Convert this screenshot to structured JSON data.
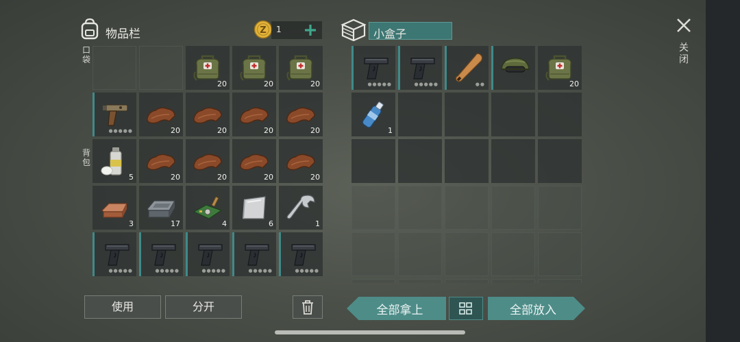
{
  "inventory": {
    "title": "物品栏",
    "coin_count": "1"
  },
  "container": {
    "title": "小盒子"
  },
  "side_labels": {
    "pocket": "口袋",
    "backpack": "背包"
  },
  "close_label": "关闭",
  "buttons": {
    "use": "使用",
    "split": "分开",
    "take_all": "全部拿上",
    "put_all": "全部放入"
  },
  "inventory_rows": [
    [
      {
        "icon": "empty"
      },
      {
        "icon": "empty"
      },
      {
        "icon": "medkit",
        "count": "20"
      },
      {
        "icon": "medkit",
        "count": "20"
      },
      {
        "icon": "medkit",
        "count": "20"
      }
    ],
    [
      {
        "icon": "flare-gun",
        "durability": true
      },
      {
        "icon": "leather",
        "count": "20"
      },
      {
        "icon": "leather",
        "count": "20"
      },
      {
        "icon": "leather",
        "count": "20"
      },
      {
        "icon": "leather",
        "count": "20"
      }
    ],
    [
      {
        "icon": "spray-can",
        "count": "5"
      },
      {
        "icon": "leather",
        "count": "20"
      },
      {
        "icon": "leather",
        "count": "20"
      },
      {
        "icon": "leather",
        "count": "20"
      },
      {
        "icon": "leather",
        "count": "20"
      }
    ],
    [
      {
        "icon": "copper-ingot",
        "count": "3"
      },
      {
        "icon": "iron-ingot",
        "count": "17"
      },
      {
        "icon": "circuit-board",
        "count": "4"
      },
      {
        "icon": "metal-sheet",
        "count": "6"
      },
      {
        "icon": "wrench",
        "count": "1"
      }
    ],
    [
      {
        "icon": "pistol",
        "durability": true
      },
      {
        "icon": "pistol",
        "durability": true
      },
      {
        "icon": "pistol",
        "durability": true
      },
      {
        "icon": "pistol",
        "durability": true
      },
      {
        "icon": "pistol",
        "durability": true
      }
    ]
  ],
  "container_rows": [
    [
      {
        "icon": "pistol",
        "durability": true
      },
      {
        "icon": "pistol",
        "durability": true
      },
      {
        "icon": "baseball-bat",
        "durability": true
      },
      {
        "icon": "tactical-helmet",
        "durability": false
      },
      {
        "icon": "medkit",
        "count": "20"
      }
    ],
    [
      {
        "icon": "water-bottle",
        "count": "1"
      },
      {
        "icon": "filled"
      },
      {
        "icon": "filled"
      },
      {
        "icon": "filled"
      },
      {
        "icon": "filled"
      }
    ],
    [
      {
        "icon": "filled"
      },
      {
        "icon": "filled"
      },
      {
        "icon": "filled"
      },
      {
        "icon": "filled"
      },
      {
        "icon": "filled"
      }
    ],
    [
      {
        "icon": "empty"
      },
      {
        "icon": "empty"
      },
      {
        "icon": "empty"
      },
      {
        "icon": "empty"
      },
      {
        "icon": "empty"
      }
    ],
    [
      {
        "icon": "empty"
      },
      {
        "icon": "empty"
      },
      {
        "icon": "empty"
      },
      {
        "icon": "empty"
      },
      {
        "icon": "empty"
      }
    ],
    [
      {
        "icon": "empty"
      },
      {
        "icon": "empty"
      },
      {
        "icon": "empty"
      },
      {
        "icon": "empty"
      },
      {
        "icon": "empty"
      }
    ]
  ],
  "colors": {
    "accent": "#4e8c88",
    "add": "#3fa68c",
    "coin": "#e3b43a"
  }
}
